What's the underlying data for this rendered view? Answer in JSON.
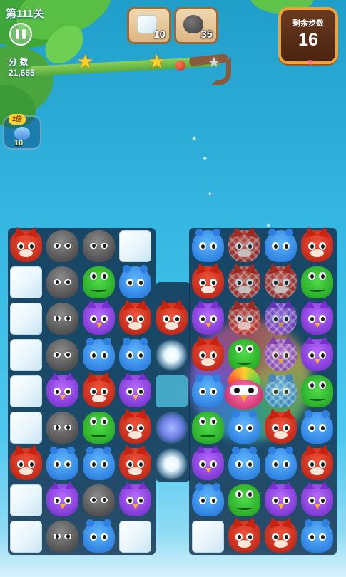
{
  "hud": {
    "level_title": "第111关",
    "score_label": "分 数",
    "score_value": "21,665",
    "stars_filled": 2,
    "stars_total": 3
  },
  "goals": [
    {
      "icon": "ice-block-icon",
      "count": "10"
    },
    {
      "icon": "gray-furball-icon",
      "count": "35"
    }
  ],
  "moves": {
    "label": "剩余步数",
    "value": "16"
  },
  "booster": {
    "badge": "2倍",
    "icon": "blue-creature-icon",
    "count": "10"
  },
  "board": {
    "columns": 9,
    "rows": 9,
    "legend": {
      "fox": "red fox",
      "fur": "gray furball",
      "frog": "green frog",
      "blue": "blue blob",
      "owl": "purple owl",
      "ice": "ice block",
      "dandelion": "white dandelion puff",
      "dusk": "blue dandelion puff",
      "cage_fox": "caged red fox",
      "cage_blue": "caged blue blob",
      "cage_owl": "caged purple owl",
      "teal": "empty teal cell",
      "bird": "rainbow bird special"
    },
    "grid": [
      [
        "fox",
        "fur",
        "fur",
        "ice",
        null,
        "blue",
        "cage_fox",
        "blue",
        "fox"
      ],
      [
        "ice",
        "fur",
        "frog",
        "blue",
        null,
        "fox",
        "cage_fox",
        "cage_fox",
        "frog"
      ],
      [
        "ice",
        "fur",
        "owl",
        "fox",
        "fox",
        "owl",
        "cage_fox",
        "cage_owl",
        "owl"
      ],
      [
        "ice",
        "fur",
        "blue",
        "blue",
        "dandelion",
        "fox",
        "frog",
        "cage_owl",
        "owl"
      ],
      [
        "ice",
        "owl",
        "fox",
        "owl",
        "teal",
        "blue",
        "bird",
        "cage_blue",
        "frog"
      ],
      [
        "ice",
        "fur",
        "frog",
        "fox",
        "dusk",
        "frog",
        "blue",
        "fox",
        "blue"
      ],
      [
        "fox",
        "blue",
        "blue",
        "fox",
        "dandelion",
        "owl",
        "blue",
        "blue",
        "fox"
      ],
      [
        "ice",
        "owl",
        "fur",
        "owl",
        null,
        "blue",
        "frog",
        "owl",
        "owl"
      ],
      [
        "ice",
        "fur",
        "blue",
        "ice",
        null,
        "ice",
        "fox",
        "fox",
        "blue"
      ]
    ]
  },
  "colors": {
    "sky_top": "#1f9ec9",
    "sky_bottom": "#d7f1fb",
    "moves_panel": "#4a2410",
    "moves_border": "#f0a23a",
    "star": "#ffcf2a"
  }
}
